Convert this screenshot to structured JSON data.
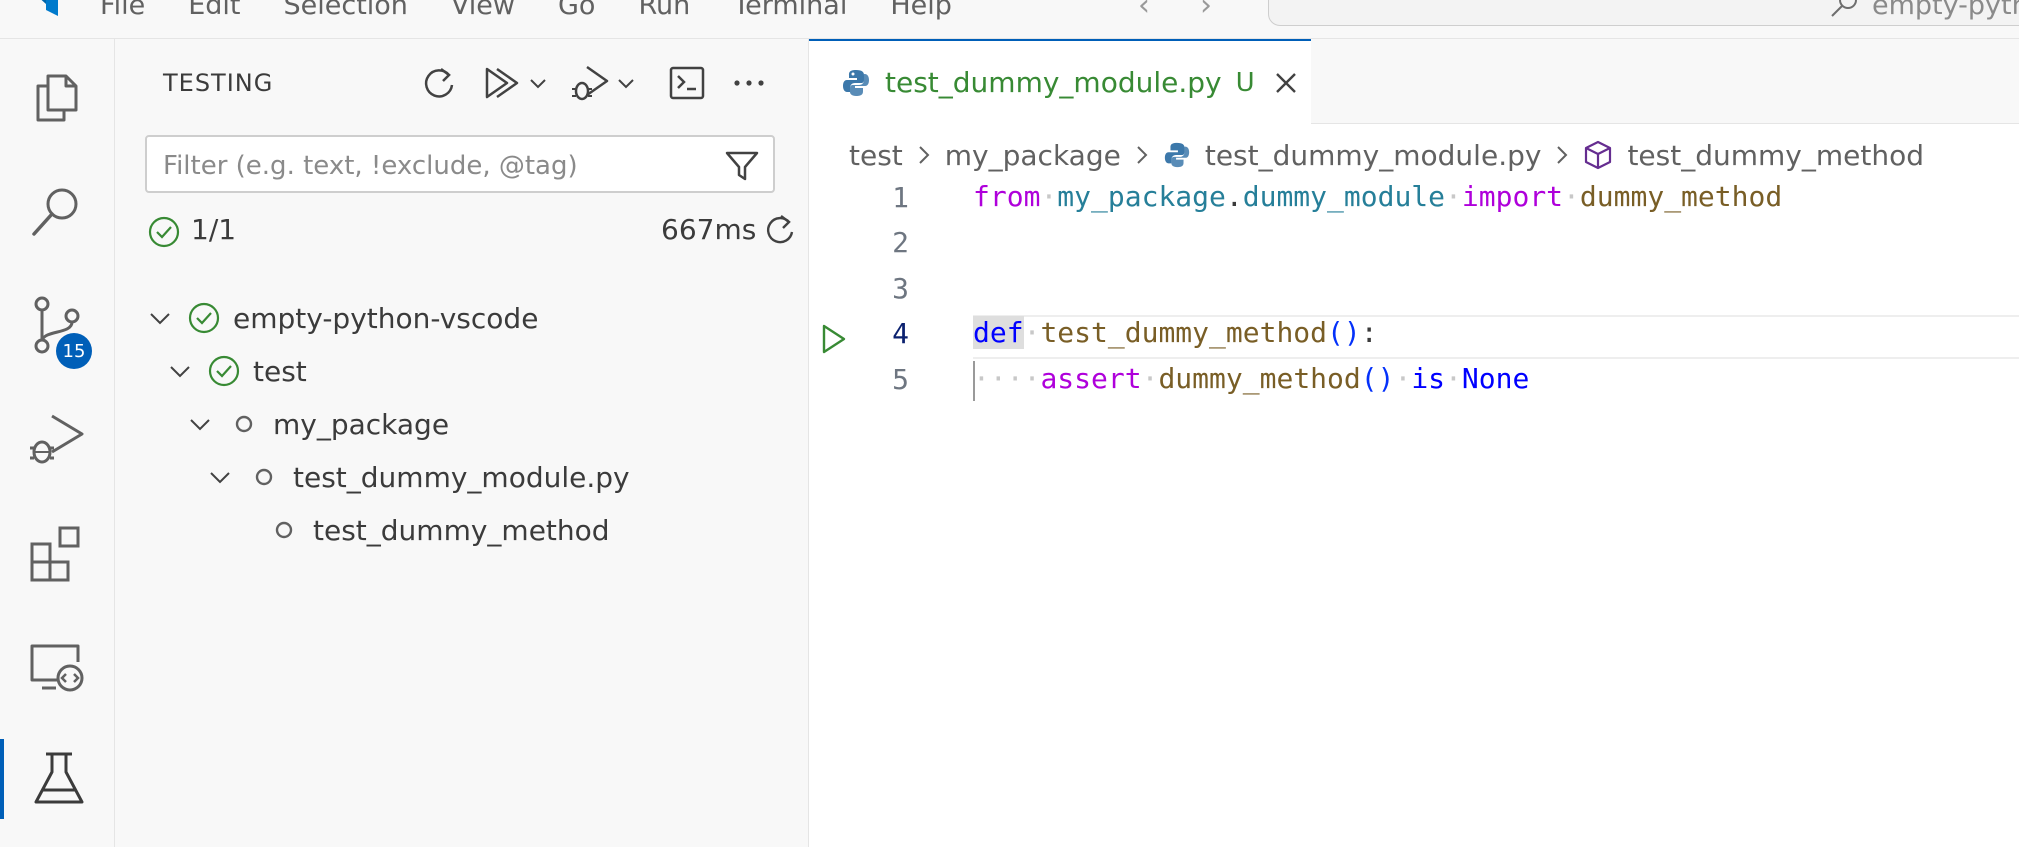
{
  "menu": {
    "items": [
      "File",
      "Edit",
      "Selection",
      "View",
      "Go",
      "Run",
      "Terminal",
      "Help"
    ]
  },
  "search": {
    "text": "empty-pyth"
  },
  "activity_bar": {
    "items": [
      {
        "name": "explorer",
        "icon": "files-icon"
      },
      {
        "name": "search",
        "icon": "search-icon"
      },
      {
        "name": "source-control",
        "icon": "source-control-icon",
        "badge": "15"
      },
      {
        "name": "run-debug",
        "icon": "debug-icon"
      },
      {
        "name": "extensions",
        "icon": "extensions-icon"
      },
      {
        "name": "remote-explorer",
        "icon": "remote-explorer-icon"
      },
      {
        "name": "testing",
        "icon": "beaker-icon",
        "active": true
      }
    ]
  },
  "sidebar": {
    "title": "TESTING",
    "filter_placeholder": "Filter (e.g. text, !exclude, @tag)",
    "summary": {
      "count": "1/1",
      "duration": "667ms"
    },
    "tree": [
      {
        "label": "empty-python-vscode",
        "depth": 0,
        "expanded": true,
        "status": "passed"
      },
      {
        "label": "test",
        "depth": 1,
        "expanded": true,
        "status": "passed"
      },
      {
        "label": "my_package",
        "depth": 2,
        "expanded": true,
        "status": "unset"
      },
      {
        "label": "test_dummy_module.py",
        "depth": 3,
        "expanded": true,
        "status": "unset"
      },
      {
        "label": "test_dummy_method",
        "depth": 4,
        "expanded": false,
        "status": "unset"
      }
    ]
  },
  "editor": {
    "tab": {
      "name": "test_dummy_module.py",
      "decoration": "U"
    },
    "breadcrumb": {
      "parts": [
        "test",
        "my_package",
        "test_dummy_module.py",
        "test_dummy_method"
      ]
    },
    "lines": [
      {
        "n": "1"
      },
      {
        "n": "2"
      },
      {
        "n": "3"
      },
      {
        "n": "4",
        "current": true
      },
      {
        "n": "5"
      }
    ],
    "code": {
      "l1": {
        "from": "from",
        "module": "my_package",
        "dot": ".",
        "sub": "dummy_module",
        "import": "import",
        "name": "dummy_method"
      },
      "l4": {
        "def": "def",
        "fn": "test_dummy_method",
        "parens": "()",
        "colon": ":"
      },
      "l5": {
        "assert": "assert",
        "fn": "dummy_method",
        "parens": "()",
        "is": "is",
        "none": "None"
      }
    }
  },
  "colors": {
    "accent": "#005fb8",
    "passed": "#388a34",
    "untracked": "#388a34",
    "keyword_flow": "#af00db",
    "keyword": "#0000ff",
    "function": "#795e26",
    "module": "#267f99"
  }
}
